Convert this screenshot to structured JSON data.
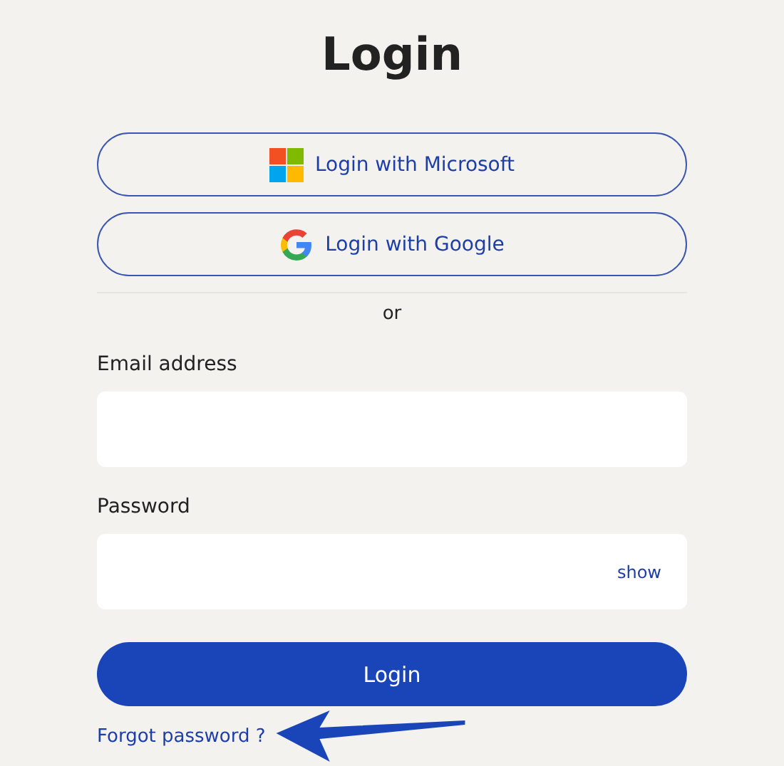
{
  "title": "Login",
  "sso_buttons": [
    {
      "kind": "microsoft",
      "label": "Login with Microsoft"
    },
    {
      "kind": "google",
      "label": "Login with Google"
    }
  ],
  "divider": "or",
  "fields": [
    {
      "label": "Email address"
    },
    {
      "label": "Password",
      "toggle": "show"
    }
  ],
  "submit": "Login",
  "forgot_link": "Forgot password ?"
}
